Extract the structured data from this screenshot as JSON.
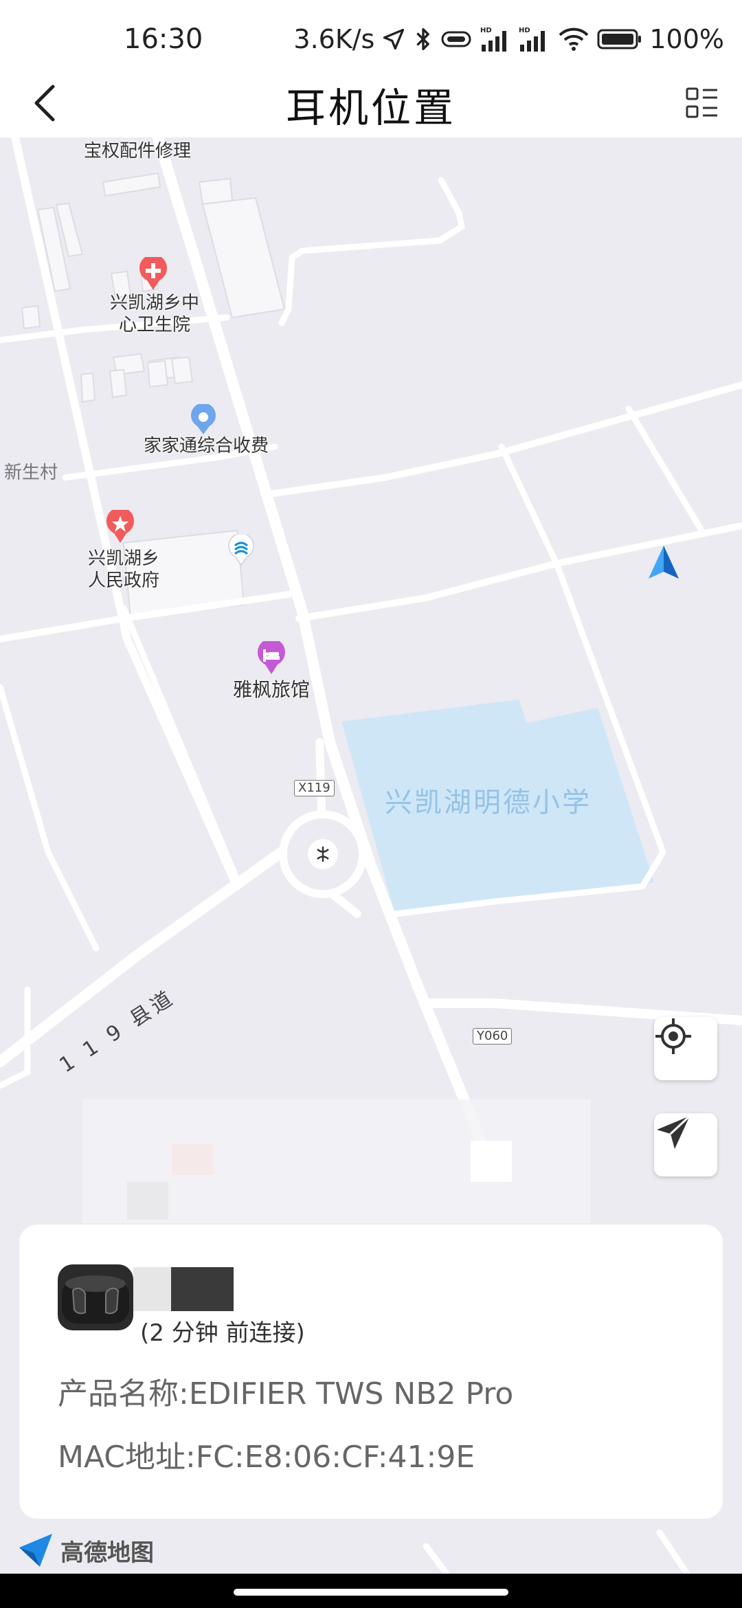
{
  "status_bar": {
    "time": "16:30",
    "network_speed": "3.6K/s",
    "battery": "100%",
    "icons": [
      "location-arrow-icon",
      "bluetooth-icon",
      "headset-battery-icon",
      "signal-hd-icon",
      "signal-hd-icon",
      "wifi-icon",
      "battery-icon"
    ]
  },
  "title_bar": {
    "title": "耳机位置",
    "back_icon": "chevron-left-icon",
    "menu_icon": "list-icon"
  },
  "map": {
    "pois": [
      {
        "id": "repair",
        "label": "宝权配件修理"
      },
      {
        "id": "hospital",
        "label_line1": "兴凯湖乡中",
        "label_line2": "心卫生院",
        "icon": "hospital-icon"
      },
      {
        "id": "fee",
        "label": "家家通综合收费",
        "icon": "pin-icon"
      },
      {
        "id": "government",
        "label_line1": "兴凯湖乡",
        "label_line2": "人民政府",
        "icon": "government-icon"
      },
      {
        "id": "hotel",
        "label": "雅枫旅馆",
        "icon": "hotel-icon"
      },
      {
        "id": "mobile",
        "icon": "china-mobile-icon"
      }
    ],
    "area_label": "新生村",
    "school_label": "兴凯湖明德小学",
    "county_road_label": "1 1 9 县道",
    "road_badges": {
      "x119": "X119",
      "y060": "Y060"
    },
    "buttons": {
      "locate_icon": "crosshair-icon",
      "navigate_icon": "send-arrow-icon"
    },
    "colors": {
      "background": "#ebebf1",
      "road": "#ffffff",
      "school_area": "#cfe6f7",
      "accent": "#1e88e5"
    }
  },
  "device_card": {
    "connect_time": "(2 分钟 前连接)",
    "product_name": "产品名称:EDIFIER  TWS NB2 Pro",
    "mac_address": "MAC地址:FC:E8:06:CF:41:9E"
  },
  "map_provider": {
    "name": "高德地图",
    "icon": "amap-logo-icon"
  }
}
